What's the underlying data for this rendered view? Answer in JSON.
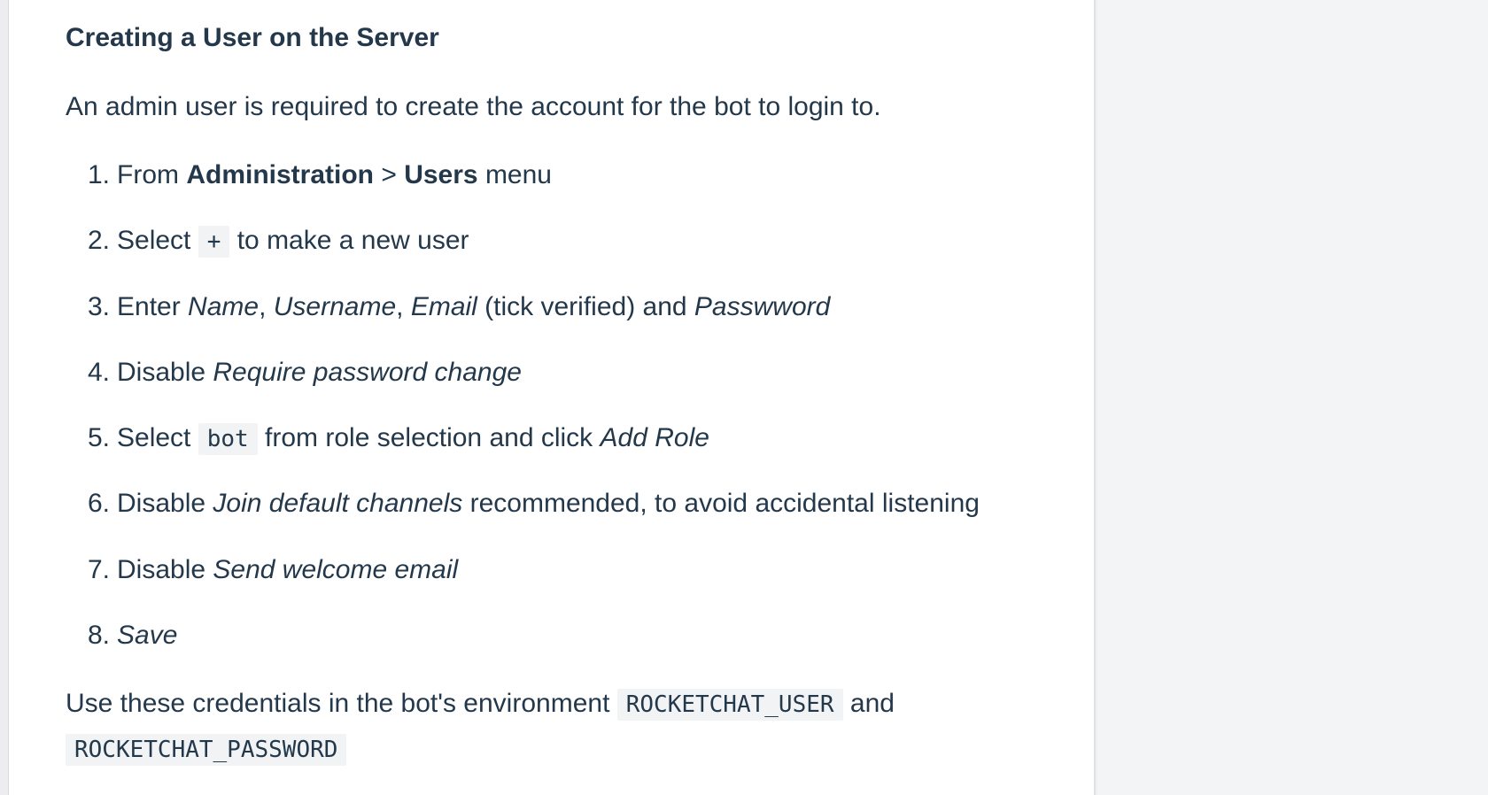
{
  "section_title": "Creating a User on the Server",
  "intro_text": "An admin user is required to create the account for the bot to login to.",
  "steps": [
    {
      "num": "1.",
      "a": "From ",
      "b": "Administration",
      "c": " > ",
      "d": "Users",
      "e": " menu"
    },
    {
      "num": "2.",
      "a": "Select ",
      "code": "+",
      "b": " to make a new user"
    },
    {
      "num": "3.",
      "a": "Enter ",
      "i1": "Name",
      "s1": ", ",
      "i2": "Username",
      "s2": ", ",
      "i3": "Email",
      "s3": " (tick verified) and ",
      "i4": "Passwword"
    },
    {
      "num": "4.",
      "a": "Disable ",
      "i": "Require password change"
    },
    {
      "num": "5.",
      "a": "Select ",
      "code": "bot",
      "b": " from role selection and click ",
      "i": "Add Role"
    },
    {
      "num": "6.",
      "a": "Disable ",
      "i": "Join default channels",
      "b": " recommended, to avoid accidental listening"
    },
    {
      "num": "7.",
      "a": "Disable ",
      "i": "Send welcome email"
    },
    {
      "num": "8.",
      "i": "Save"
    }
  ],
  "outro": {
    "text1": "Use these credentials in the bot's environment ",
    "code1": "ROCKETCHAT_USER",
    "text2": " and",
    "code2": "ROCKETCHAT_PASSWORD"
  }
}
